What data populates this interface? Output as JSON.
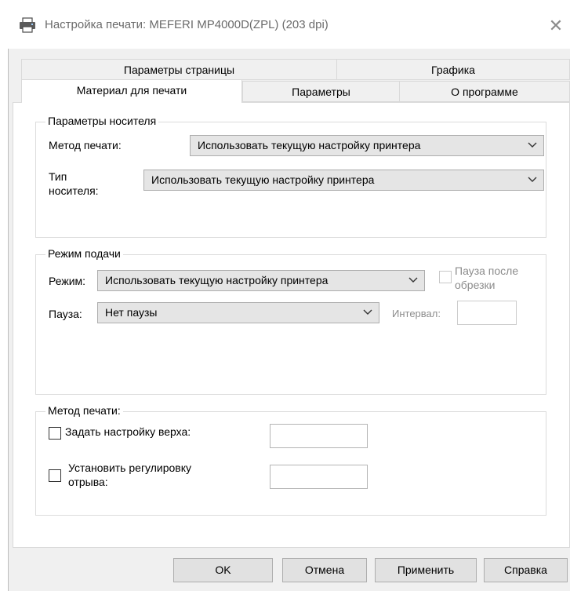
{
  "window": {
    "title": "Настройка печати: MEFERI MP4000D(ZPL) (203 dpi)",
    "close_glyph": "✕"
  },
  "tabs": {
    "row1": [
      "Параметры страницы",
      "Графика"
    ],
    "row2": [
      "Материал для печати",
      "Параметры",
      "О программе"
    ],
    "active": "Материал для печати"
  },
  "media_group": {
    "title": "Параметры носителя",
    "print_method_label": "Метод печати:",
    "print_method_value": "Использовать текущую настройку принтера",
    "media_type_label_line1": "Тип",
    "media_type_label_line2": "носителя:",
    "media_type_value": "Использовать текущую настройку принтера"
  },
  "feed_group": {
    "title": "Режим подачи",
    "mode_label": "Режим:",
    "mode_value": "Использовать текущую настройку принтера",
    "pause_after_cut_line1": "Пауза после",
    "pause_after_cut_line2": "обрезки",
    "pause_label": "Пауза:",
    "pause_value": "Нет паузы",
    "interval_label": "Интервал:"
  },
  "method_group": {
    "title": "Метод печати:",
    "top_setting_label": "Задать настройку верха:",
    "tear_off_line1": "Установить регулировку",
    "tear_off_line2": "отрыва:"
  },
  "buttons": {
    "ok": "OK",
    "cancel": "Отмена",
    "apply": "Применить",
    "help": "Справка"
  },
  "colors": {
    "window_bg": "#ffffff",
    "dialog_bg": "#f0f0f0",
    "combo_bg": "#e5e5e5",
    "button_bg": "#e1e1e1",
    "disabled_text": "#8c8c8c"
  }
}
